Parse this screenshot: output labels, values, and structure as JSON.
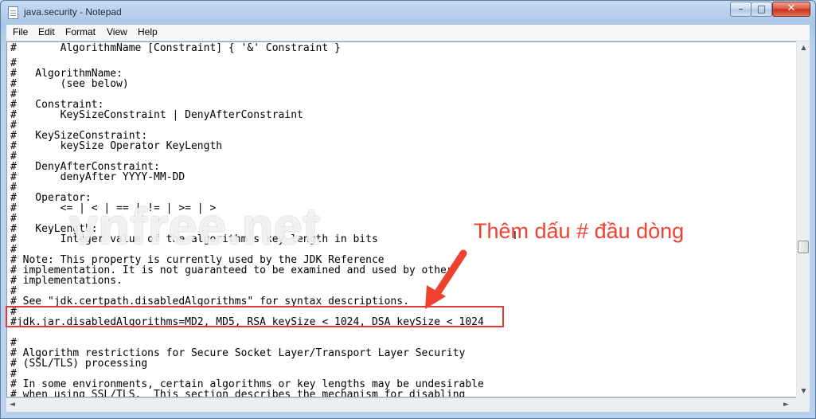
{
  "window": {
    "title": "java.security - Notepad",
    "controls": {
      "minimize": "–",
      "maximize": "□",
      "close": "✕"
    }
  },
  "menu": [
    "File",
    "Edit",
    "Format",
    "View",
    "Help"
  ],
  "editor_lines": [
    "#       AlgorithmName [Constraint] { '&' Constraint }",
    "#",
    "#   AlgorithmName:",
    "#       (see below)",
    "#",
    "#   Constraint:",
    "#       KeySizeConstraint | DenyAfterConstraint",
    "#",
    "#   KeySizeConstraint:",
    "#       keySize Operator KeyLength",
    "#",
    "#   DenyAfterConstraint:",
    "#       denyAfter YYYY-MM-DD",
    "#",
    "#   Operator:",
    "#       <= | < | == | != | >= | >",
    "#",
    "#   KeyLength:",
    "#       Integer value of the algorithm's key length in bits",
    "#",
    "# Note: This property is currently used by the JDK Reference",
    "# implementation. It is not guaranteed to be examined and used by other",
    "# implementations.",
    "#",
    "# See \"jdk.certpath.disabledAlgorithms\" for syntax descriptions.",
    "#",
    "#jdk.jar.disabledAlgorithms=MD2, MD5, RSA keySize < 1024, DSA keySize < 1024",
    "",
    "#",
    "# Algorithm restrictions for Secure Socket Layer/Transport Layer Security",
    "# (SSL/TLS) processing",
    "#",
    "# In some environments, certain algorithms or key lengths may be undesirable",
    "# when using SSL/TLS.  This section describes the mechanism for disabling"
  ],
  "overlay": {
    "watermark": "vnfree.net",
    "annotation": "Thêm dấu # đầu dòng",
    "accent_color": "#ee4130"
  },
  "scrollbars": {
    "up": "▲",
    "down": "▼",
    "left": "◄",
    "right": "►"
  }
}
